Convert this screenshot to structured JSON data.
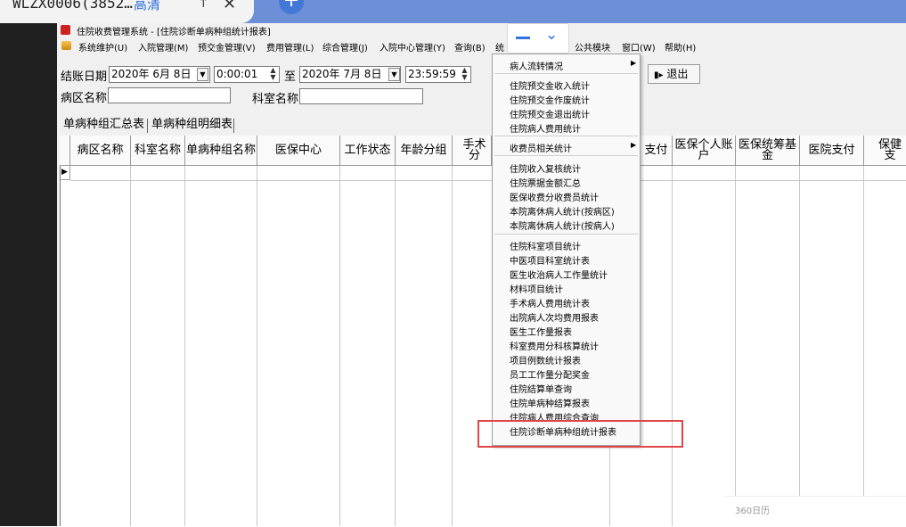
{
  "browser": {
    "tab_title": "WLZX0006(3852…",
    "tab_subtitle": "高清",
    "tab_pin": "↑",
    "tab_close": "✕",
    "new_tab": "+"
  },
  "window": {
    "title": "住院收费管理系统 - [住院诊断单病种组统计报表]"
  },
  "menu": [
    "系统维护(U)",
    "入院管理(M)",
    "预交金管理(V)",
    "费用管理(L)",
    "综合管理(J)",
    "入院中心管理(Y)",
    "查询(B)",
    "统",
    "公共模块",
    "窗口(W)",
    "帮助(H)"
  ],
  "filters": {
    "settle_date_label": "结账日期",
    "date_from": "2020年 6月 8日",
    "time_from": "0:00:01",
    "to_label": "至",
    "date_to": "2020年 7月 8日",
    "time_to": "23:59:59",
    "ward_label": "病区名称",
    "ward_value": "",
    "dept_label": "科室名称",
    "dept_value": ""
  },
  "toolbar": {
    "exit_label": "退出"
  },
  "tabs": [
    "单病种组汇总表",
    "单病种组明细表"
  ],
  "table": {
    "columns": [
      "病区名称",
      "科室名称",
      "单病种组名称",
      "医保中心",
      "工作状态",
      "年龄分组",
      "手术分",
      "支付",
      "医保个人账户",
      "医保统筹基金",
      "医院支付",
      "保健支"
    ],
    "rows": []
  },
  "popup_menu": {
    "items": [
      "病人流转情况",
      "住院预交金收入统计",
      "住院预交金作废统计",
      "住院预交金退出统计",
      "住院病人费用统计",
      "收费员相关统计",
      "住院收入复核统计",
      "住院票据金额汇总",
      "医保收费分收费员统计",
      "本院离休病人统计(按病区)",
      "本院离休病人统计(按病人)",
      "住院科室项目统计",
      "中医项目科室统计表",
      "医生收治病人工作量统计",
      "材料项目统计",
      "手术病人费用统计表",
      "出院病人次均费用报表",
      "医生工作量报表",
      "科室费用分科核算统计",
      "项目例数统计报表",
      "员工工作量分配奖金",
      "住院结算单查询",
      "住院单病种结算报表",
      "住院病人费用综合查询",
      "住院诊断单病种组统计报表"
    ],
    "highlighted": "住院诊断单病种组统计报表"
  },
  "calendar_widget": {
    "label": "360日历"
  },
  "colors": {
    "highlight": "#e04646",
    "accent": "#2f72e0"
  }
}
